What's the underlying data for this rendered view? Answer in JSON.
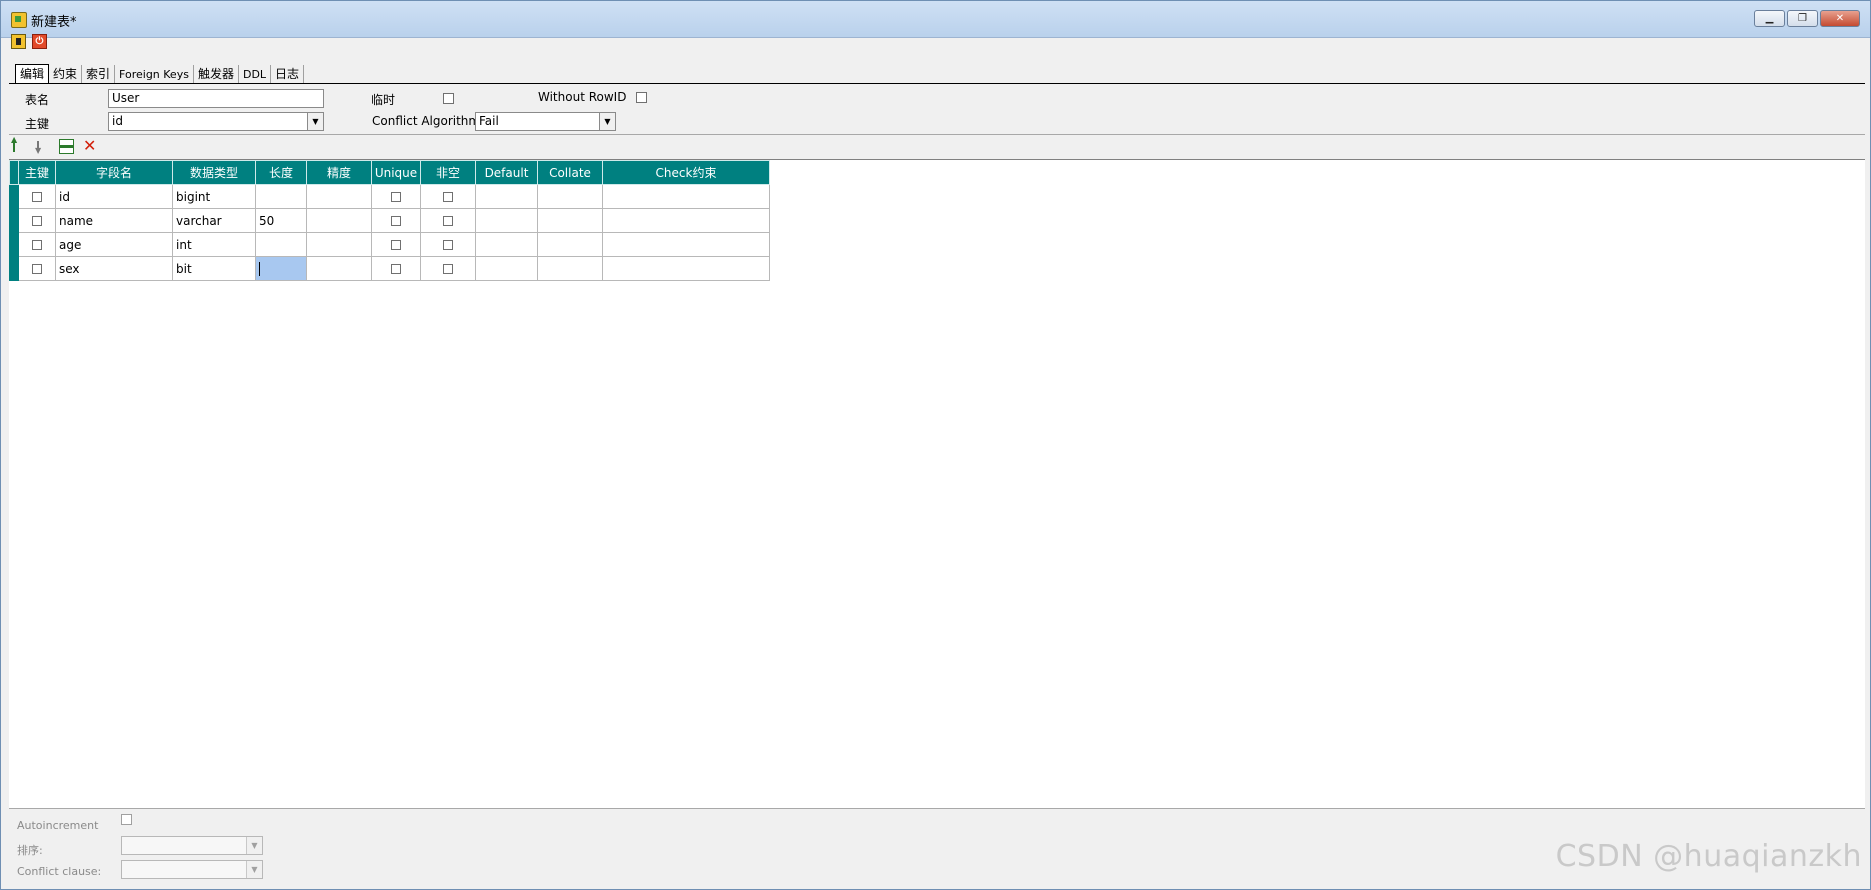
{
  "window": {
    "title": "新建表*",
    "minimize_label": "▁",
    "restore_label": "❐",
    "close_label": "✕"
  },
  "toolbar": {
    "save_icon": "save-icon",
    "close_icon": "close-icon",
    "close_glyph": "⏻"
  },
  "tabs": [
    "编辑",
    "约束",
    "索引",
    "Foreign Keys",
    "触发器",
    "DDL",
    "日志"
  ],
  "form": {
    "table_name_label": "表名",
    "table_name_value": "User",
    "primary_key_label": "主键",
    "primary_key_value": "id",
    "temporary_label": "临时",
    "without_rowid_label": "Without RowID",
    "conflict_label": "Conflict Algorithm",
    "conflict_value": "Fail"
  },
  "grid": {
    "headers": [
      "主键",
      "字段名",
      "数据类型",
      "长度",
      "精度",
      "Unique",
      "非空",
      "Default",
      "Collate",
      "Check约束"
    ],
    "rows": [
      {
        "pk": false,
        "name": "id",
        "type": "bigint",
        "length": "",
        "precision": "",
        "unique": false,
        "notnull": false,
        "default": "",
        "collate": "",
        "check": ""
      },
      {
        "pk": false,
        "name": "name",
        "type": "varchar",
        "length": "50",
        "precision": "",
        "unique": false,
        "notnull": false,
        "default": "",
        "collate": "",
        "check": ""
      },
      {
        "pk": false,
        "name": "age",
        "type": "int",
        "length": "",
        "precision": "",
        "unique": false,
        "notnull": false,
        "default": "",
        "collate": "",
        "check": ""
      },
      {
        "pk": false,
        "name": "sex",
        "type": "bit",
        "length": "",
        "precision": "",
        "unique": false,
        "notnull": false,
        "default": "",
        "collate": "",
        "check": ""
      }
    ],
    "header_color": "#008080"
  },
  "bottom": {
    "autoincrement_label": "Autoincrement",
    "sort_label": "排序:",
    "conflict_clause_label": "Conflict clause:"
  },
  "watermark": "CSDN @huaqianzkh"
}
